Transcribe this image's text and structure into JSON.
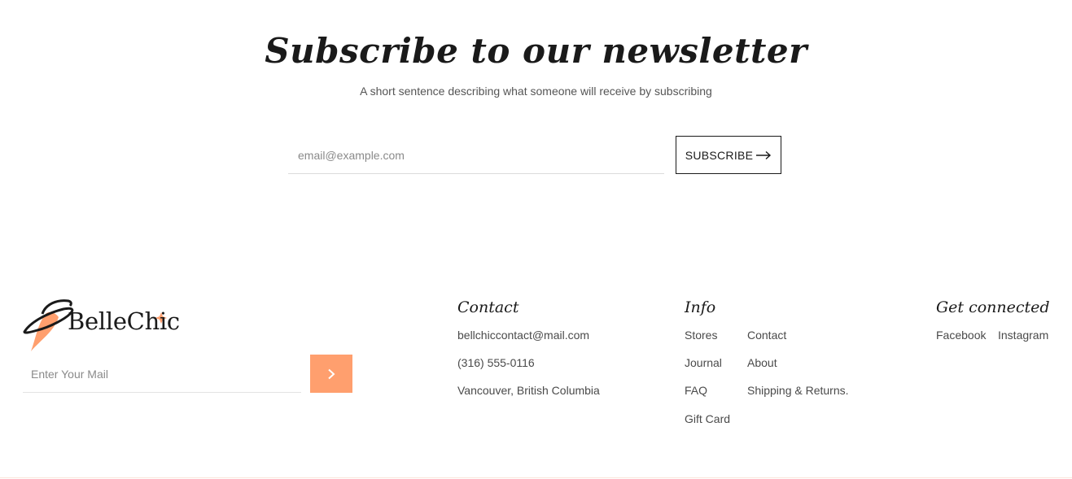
{
  "newsletter": {
    "title": "Subscribe to our newsletter",
    "subtitle": "A short sentence describing what someone will receive by subscribing",
    "email_placeholder": "email@example.com",
    "button_label": "SUBSCRIBE"
  },
  "footer": {
    "brand": {
      "name": "BelleChic",
      "accent_color": "#ff9f6e",
      "mail_placeholder": "Enter Your Mail"
    },
    "contact": {
      "heading": "Contact",
      "email": "bellchiccontact@mail.com",
      "phone": "(316) 555-0116",
      "address": "Vancouver, British Columbia"
    },
    "info": {
      "heading": "Info",
      "links": [
        "Stores",
        "Contact",
        "Journal",
        "About",
        "FAQ",
        "Shipping & Returns.",
        "Gift Card"
      ]
    },
    "connect": {
      "heading": "Get connected",
      "links": [
        "Facebook",
        "Instagram"
      ]
    }
  }
}
